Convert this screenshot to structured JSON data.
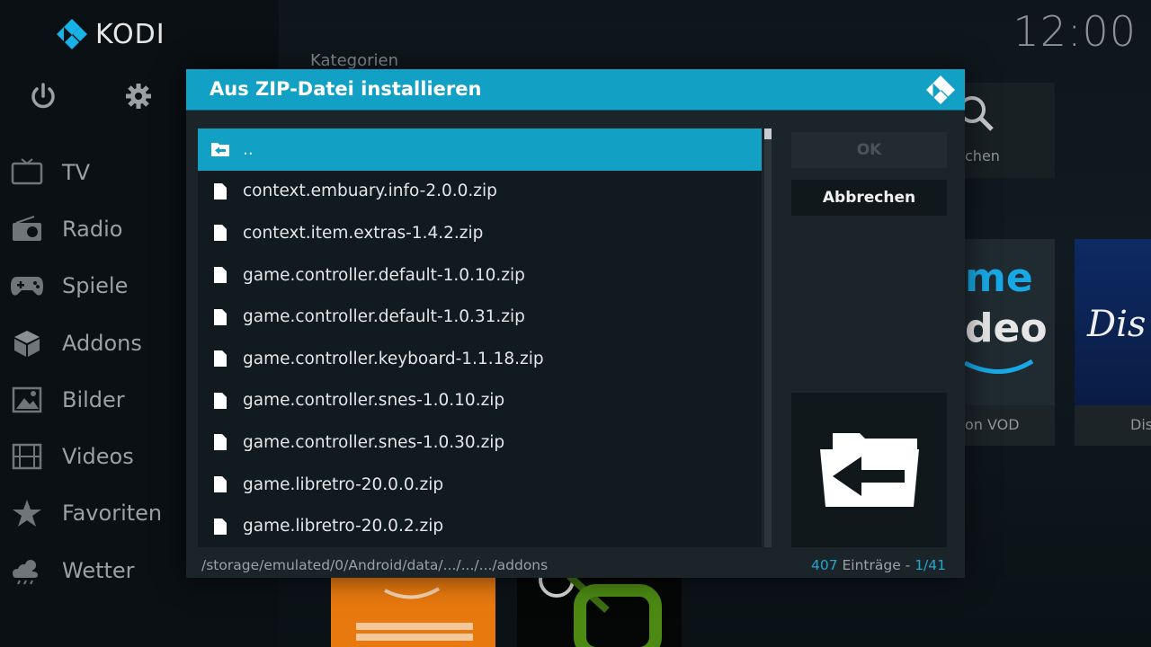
{
  "app": {
    "name": "KODI",
    "clock": "12:00"
  },
  "home": {
    "section_title": "Kategorien",
    "menu": [
      {
        "label": "TV",
        "icon": "tv-icon"
      },
      {
        "label": "Radio",
        "icon": "radio-icon"
      },
      {
        "label": "Spiele",
        "icon": "gamepad-icon"
      },
      {
        "label": "Addons",
        "icon": "box-icon"
      },
      {
        "label": "Bilder",
        "icon": "picture-icon"
      },
      {
        "label": "Videos",
        "icon": "film-icon"
      },
      {
        "label": "Favoriten",
        "icon": "star-icon"
      },
      {
        "label": "Wetter",
        "icon": "weather-icon"
      }
    ],
    "tile_labels": {
      "search_partial": "chen",
      "vod_partial": "on VOD",
      "disney_partial": "Dis"
    }
  },
  "dialog": {
    "title": "Aus ZIP-Datei installieren",
    "items": [
      {
        "label": "..",
        "type": "parent",
        "selected": true
      },
      {
        "label": "context.embuary.info-2.0.0.zip",
        "type": "file"
      },
      {
        "label": "context.item.extras-1.4.2.zip",
        "type": "file"
      },
      {
        "label": "game.controller.default-1.0.10.zip",
        "type": "file"
      },
      {
        "label": "game.controller.default-1.0.31.zip",
        "type": "file"
      },
      {
        "label": "game.controller.keyboard-1.1.18.zip",
        "type": "file"
      },
      {
        "label": "game.controller.snes-1.0.10.zip",
        "type": "file"
      },
      {
        "label": "game.controller.snes-1.0.30.zip",
        "type": "file"
      },
      {
        "label": "game.libretro-20.0.0.zip",
        "type": "file"
      },
      {
        "label": "game.libretro-20.0.2.zip",
        "type": "file"
      }
    ],
    "ok_label": "OK",
    "cancel_label": "Abbrechen",
    "path": "/storage/emulated/0/Android/data/.../.../.../addons",
    "count": "407",
    "count_label": " Einträge - ",
    "page": "1/41"
  },
  "colors": {
    "accent": "#12a0c4",
    "dialog_bg": "#1a2429",
    "list_bg": "#111a1e"
  }
}
